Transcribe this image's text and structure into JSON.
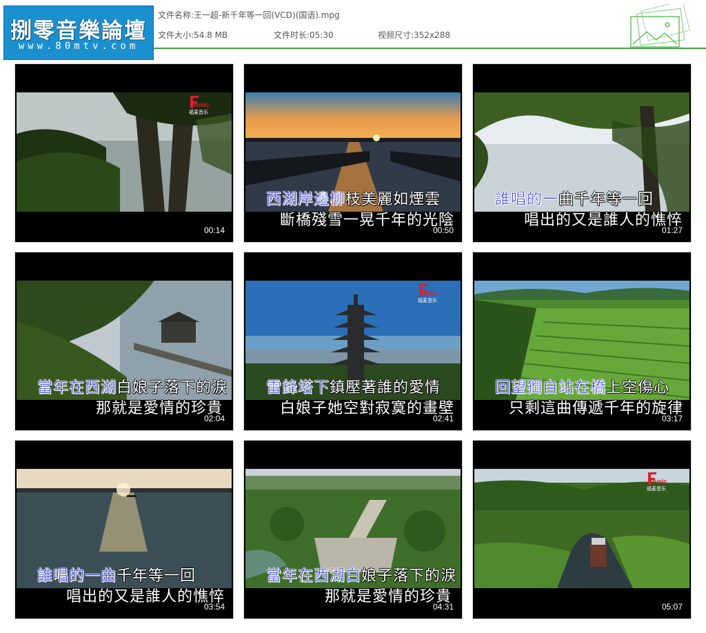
{
  "logo": {
    "title": "捌零音樂論壇",
    "url": "www.80mtv.com"
  },
  "file_info": {
    "name_label": "文件名称:",
    "name_value": "王一超-新千年等一回(VCD)(国语).mpg",
    "size_label": "文件大小:",
    "size_value": "54.8 MB",
    "duration_label": "文件时长:",
    "duration_value": "05:30",
    "dimension_label": "视频尺寸:",
    "dimension_value": "352x288"
  },
  "colors": {
    "accent_line": "#3aa53a",
    "logo_bg": "#1b90cf",
    "lyric_highlight": "#2d2fd9"
  },
  "badge_text": {
    "brand": "Music",
    "sub": "福麦音乐"
  },
  "thumbnails": [
    {
      "time": "00:14",
      "line1_hl": "",
      "line1_rest": "",
      "line2": "",
      "badge": true
    },
    {
      "time": "00:50",
      "line1_hl": "西湖岸邊柳",
      "line1_rest": "枝美麗如煙雲",
      "line2": "斷橋殘雪一晃千年的光陰",
      "badge": false
    },
    {
      "time": "01:27",
      "line1_hl": "誰唱的一",
      "line1_rest": "曲千年等一回",
      "line2": "唱出的又是誰人的憔悴",
      "badge": false
    },
    {
      "time": "02:04",
      "line1_hl": "當年在西湖",
      "line1_rest": "白娘子落下的淚",
      "line2": "那就是愛情的珍貴",
      "badge": false
    },
    {
      "time": "02:41",
      "line1_hl": "雷鋒塔下",
      "line1_rest": "鎮壓著誰的愛情",
      "line2": "白娘子她空對寂寞的畫壁",
      "badge": true
    },
    {
      "time": "03:17",
      "line1_hl": "回望獨自站在橋",
      "line1_rest": "上空傷心",
      "line2": "只剩這曲傳遞千年的旋律",
      "badge": false
    },
    {
      "time": "03:54",
      "line1_hl": "誰唱的一曲",
      "line1_rest": "千年等一回",
      "line2": "唱出的又是誰人的憔悴",
      "badge": false
    },
    {
      "time": "04:31",
      "line1_hl": "當年在西湖白",
      "line1_rest": "娘子落下的淚",
      "line2": "那就是愛情的珍貴",
      "badge": false
    },
    {
      "time": "05:07",
      "line1_hl": "",
      "line1_rest": "",
      "line2": "",
      "badge": true
    }
  ]
}
